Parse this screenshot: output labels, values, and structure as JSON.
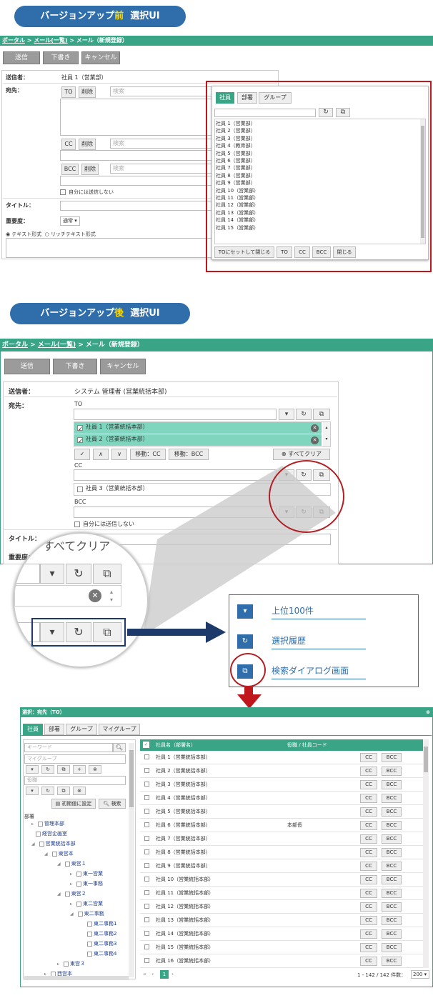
{
  "before": {
    "heading_prefix": "バージョンアップ",
    "heading_highlight": "前",
    "heading_suffix": "選択UI",
    "breadcrumb": {
      "portal": "ポータル",
      "sep1": " > ",
      "list": "メール(一覧)",
      "sep2": " > ",
      "current": "メール（新規登録）"
    },
    "toolbar": {
      "send": "送信",
      "draft": "下書き",
      "cancel": "キャンセル"
    },
    "sender_label": "送信者：",
    "sender_value": "社員 1（営業部）",
    "to_label": "宛先：",
    "to_btn": "TO",
    "del_btn": "削除",
    "search_placeholder": "検索",
    "cc_btn": "CC",
    "bcc_btn": "BCC",
    "no_self": "自分には送信しない",
    "title_label": "タイトル：",
    "priority_label": "重要度：",
    "priority_value": "通常",
    "format_text": "テキスト形式",
    "format_rich": "リッチテキスト形式",
    "popup": {
      "tabs": [
        "社員",
        "部署",
        "グループ"
      ],
      "users": [
        "社員 1（営業部）",
        "社員 2（営業部）",
        "社員 3（営業部）",
        "社員 4（教育部）",
        "社員 5（営業部）",
        "社員 6（営業部）",
        "社員 7（営業部）",
        "社員 8（営業部）",
        "社員 9（営業部）",
        "社員 10（営業部）",
        "社員 11（営業部）",
        "社員 12（営業部）",
        "社員 13（営業部）",
        "社員 14（営業部）",
        "社員 15（営業部）"
      ],
      "buttons": [
        "TOにセットして閉じる",
        "TO",
        "CC",
        "BCC",
        "閉じる"
      ]
    }
  },
  "after": {
    "heading_prefix": "バージョンアップ",
    "heading_highlight": "後",
    "heading_suffix": "選択UI",
    "breadcrumb": {
      "portal": "ポータル",
      "sep1": " > ",
      "list": "メール(一覧)",
      "sep2": " > ",
      "current": "メール（新規登録）"
    },
    "toolbar": {
      "send": "送信",
      "draft": "下書き",
      "cancel": "キャンセル"
    },
    "sender_label": "送信者：",
    "sender_value": "システム 管理者 (営業統括本部)",
    "to_label": "宛先：",
    "to_title": "TO",
    "to_rows": [
      "社員 1（営業統括本部）",
      "社員 2（営業統括本部）"
    ],
    "row_controls": [
      "✓",
      "∧",
      "∨",
      "移動：CC",
      "移動：BCC"
    ],
    "clear_all": "すべてクリア",
    "cc_title": "CC",
    "cc_rows": [
      "社員 3（営業統括本部）"
    ],
    "bcc_title": "BCC",
    "no_self": "自分には送信しない",
    "title_label": "タイトル：",
    "priority_label": "重要度：",
    "zoom_text": "すべてクリア"
  },
  "legend": [
    {
      "icon": "▾",
      "label": "上位100件"
    },
    {
      "icon": "↻",
      "label": "選択履歴"
    },
    {
      "icon": "⧉",
      "label": "検索ダイアログ画面"
    }
  ],
  "dialog": {
    "title": "選択：宛先（TO）",
    "tabs": [
      "社員",
      "部署",
      "グループ",
      "マイグループ"
    ],
    "keyword_placeholder": "キーワード",
    "mygroup_placeholder": "マイグループ",
    "role_placeholder": "役職",
    "reset_btn": "初期値に設定",
    "search_btn": "検索",
    "dept_label": "部署",
    "tree": [
      "管理本部",
      "経営企画室",
      "営業統括本部",
      "東営本",
      "東営１",
      "東一営業",
      "東一事務",
      "東営２",
      "東二営業",
      "東二事務",
      "東二事務1",
      "東二事務2",
      "東二事務3",
      "東二事務4",
      "東営３",
      "西営本"
    ],
    "col_name": "社員名（部署名）",
    "col_role": "役職 / 社員コード",
    "rows": [
      {
        "name": "社員 1（営業統括本部）",
        "role": ""
      },
      {
        "name": "社員 2（営業統括本部）",
        "role": ""
      },
      {
        "name": "社員 3（営業統括本部）",
        "role": ""
      },
      {
        "name": "社員 4（営業統括本部）",
        "role": ""
      },
      {
        "name": "社員 5（営業統括本部）",
        "role": ""
      },
      {
        "name": "社員 6（営業統括本部）",
        "role": "本部長"
      },
      {
        "name": "社員 7（営業統括本部）",
        "role": ""
      },
      {
        "name": "社員 8（営業統括本部）",
        "role": ""
      },
      {
        "name": "社員 9（営業統括本部）",
        "role": ""
      },
      {
        "name": "社員 10（営業統括本部）",
        "role": ""
      },
      {
        "name": "社員 11（営業統括本部）",
        "role": ""
      },
      {
        "name": "社員 12（営業統括本部）",
        "role": ""
      },
      {
        "name": "社員 13（営業統括本部）",
        "role": ""
      },
      {
        "name": "社員 14（営業統括本部）",
        "role": ""
      },
      {
        "name": "社員 15（営業統括本部）",
        "role": ""
      },
      {
        "name": "社員 16（営業統括本部）",
        "role": ""
      }
    ],
    "cc": "CC",
    "bcc": "BCC",
    "page_first": "«",
    "page_prev": "‹",
    "page_current": "1",
    "page_next": "›",
    "count": "1 - 142 / 142 件数：",
    "per_page": "200"
  }
}
